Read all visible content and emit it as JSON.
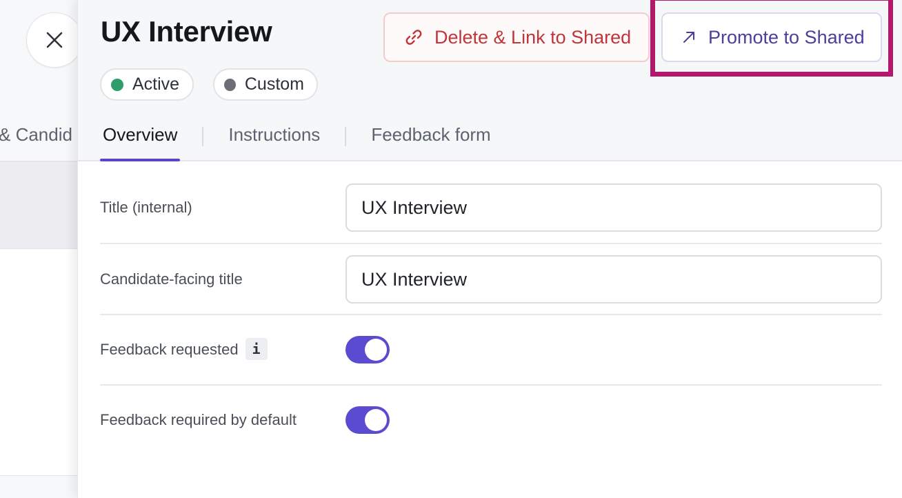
{
  "background": {
    "tab_fragment": "& Candid"
  },
  "drawer": {
    "title": "UX Interview",
    "badges": [
      {
        "label": "Active",
        "color": "#2e9e6a"
      },
      {
        "label": "Custom",
        "color": "#6b6e77"
      }
    ],
    "actions": {
      "delete_link_label": "Delete & Link to Shared",
      "promote_label": "Promote to Shared"
    },
    "tabs": [
      {
        "label": "Overview",
        "active": true
      },
      {
        "label": "Instructions",
        "active": false
      },
      {
        "label": "Feedback form",
        "active": false
      }
    ],
    "form": {
      "title_internal": {
        "label": "Title (internal)",
        "value": "UX Interview"
      },
      "candidate_title": {
        "label": "Candidate-facing title",
        "value": "UX Interview"
      },
      "feedback_requested": {
        "label": "Feedback requested",
        "info_glyph": "i",
        "enabled": true
      },
      "feedback_required": {
        "label": "Feedback required by default",
        "enabled": true
      }
    }
  },
  "colors": {
    "accent": "#5b4bd0",
    "danger": "#c0343a",
    "highlight": "#b3186b"
  },
  "icons": {
    "close": "close-icon",
    "link": "link-icon",
    "arrow": "arrow-up-right-icon",
    "info": "info-icon"
  }
}
